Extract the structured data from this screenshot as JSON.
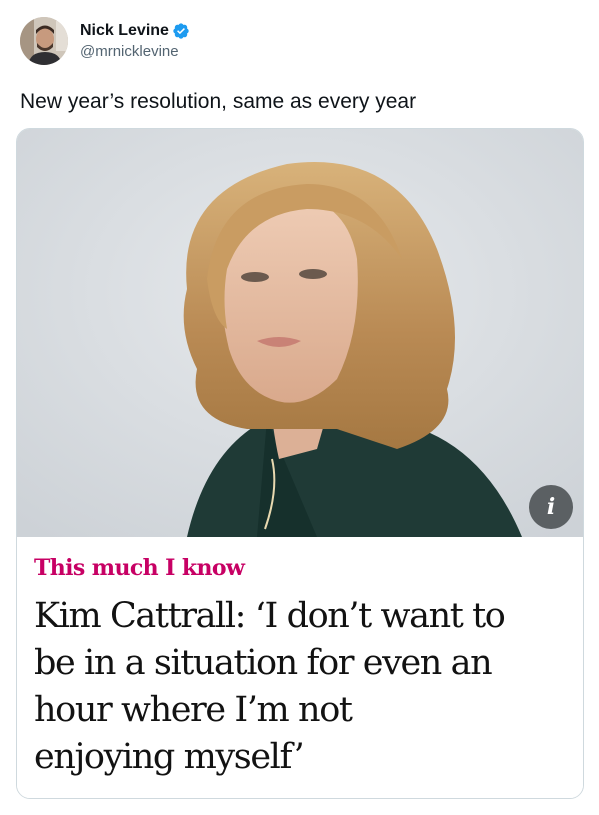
{
  "author": {
    "display_name": "Nick Levine",
    "handle": "@mrnicklevine",
    "verified": true
  },
  "tweet": {
    "text": "New year’s resolution, same as every year"
  },
  "card": {
    "kicker": "This much I know",
    "headline_lines": [
      "Kim Cattrall: ‘I don’t want to",
      "be in a situation for even an",
      "hour where I’m not",
      "enjoying myself’"
    ],
    "info_label": "i"
  },
  "colors": {
    "kicker": "#c70064",
    "verified_badge": "#1d9bf0",
    "handle": "#536471",
    "card_border": "#cfd9de"
  },
  "icons": {
    "verified": "verified-badge-icon",
    "info": "info-icon"
  }
}
